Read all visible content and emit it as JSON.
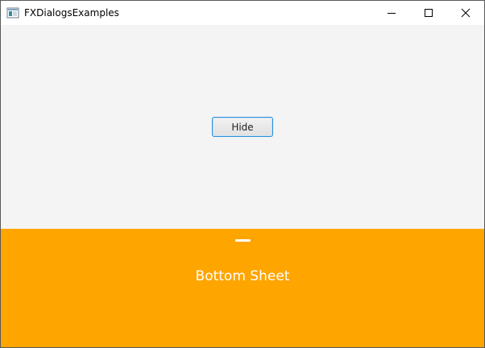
{
  "window": {
    "title": "FXDialogsExamples",
    "icon": "java-app-icon",
    "controls": {
      "minimize_icon": "minimize-icon",
      "maximize_icon": "maximize-icon",
      "close_icon": "close-icon"
    }
  },
  "content": {
    "hide_button_label": "Hide"
  },
  "bottom_sheet": {
    "label": "Bottom Sheet",
    "background_color": "#ffa500",
    "handle_icon": "drag-handle"
  }
}
